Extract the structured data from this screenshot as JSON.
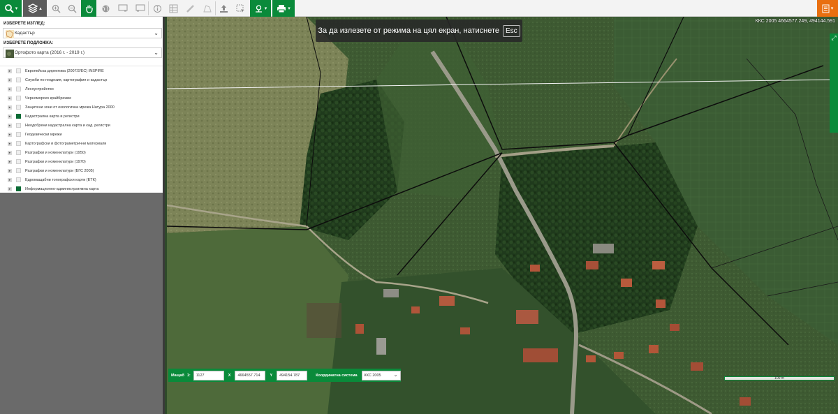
{
  "toolbar": {
    "buttons": [
      "search-icon",
      "layers-icon",
      "zoom-in-icon",
      "zoom-out-icon",
      "pan-hand-icon",
      "globe-icon",
      "previous-extent-icon",
      "next-extent-icon",
      "info-icon",
      "grid-icon",
      "measure-length-icon",
      "measure-area-icon",
      "upload-icon",
      "select-icon",
      "location-icon",
      "print-icon",
      "menu-icon"
    ]
  },
  "sidebar": {
    "view_label": "ИЗБЕРЕТЕ ИЗГЛЕД:",
    "view_value": "Кадастър",
    "basemap_label": "ИЗБЕРЕТЕ ПОДЛОЖКА:",
    "basemap_value": "Ортофото карта (2016 г. - 2019 г.)",
    "layers": [
      {
        "label": "Европейска директива (2007/2/ЕС) INSPIRE",
        "checked": false
      },
      {
        "label": "Служби по геодезия, картография и кадастър",
        "checked": false
      },
      {
        "label": "Лесоустройство",
        "checked": false
      },
      {
        "label": "Черноморско крайбрежие",
        "checked": false
      },
      {
        "label": "Защитени зони от екологична мрежа Натура 2000",
        "checked": false
      },
      {
        "label": "Кадастрална карта и регистри",
        "checked": true
      },
      {
        "label": "Неодобрени кадастрална карта и кад. регистри",
        "checked": false
      },
      {
        "label": "Геодезически мрежи",
        "checked": false
      },
      {
        "label": "Картографски и фотограметрични материали",
        "checked": false
      },
      {
        "label": "Разграфки и номенклатури (1950)",
        "checked": false
      },
      {
        "label": "Разграфки и номенклатури (1970)",
        "checked": false
      },
      {
        "label": "Разграфки и номенклатури (БГС 2005)",
        "checked": false
      },
      {
        "label": "Едромащабни топографски карти (ЕТК)",
        "checked": false
      },
      {
        "label": "Информационно-административна карта",
        "checked": true
      }
    ]
  },
  "map": {
    "fullscreen_notice": "За да излезете от режима на цял екран, натиснете",
    "fullscreen_key": "Esc",
    "coord_readout": "ККС 2005 4664577.249, 494144.591",
    "scale_bar_label": "100 m"
  },
  "statusbar": {
    "scale_label": "Мащаб",
    "scale_prefix": "1:",
    "scale_value": "1127",
    "x_label": "X",
    "x_value": "4664557.714",
    "y_label": "Y",
    "y_value": "494154.787",
    "crs_label": "Координатна система",
    "crs_value": "ККС 2005"
  },
  "colors": {
    "accent": "#0a8a3a",
    "orange": "#e96f10",
    "checked": "#0b6b35"
  }
}
